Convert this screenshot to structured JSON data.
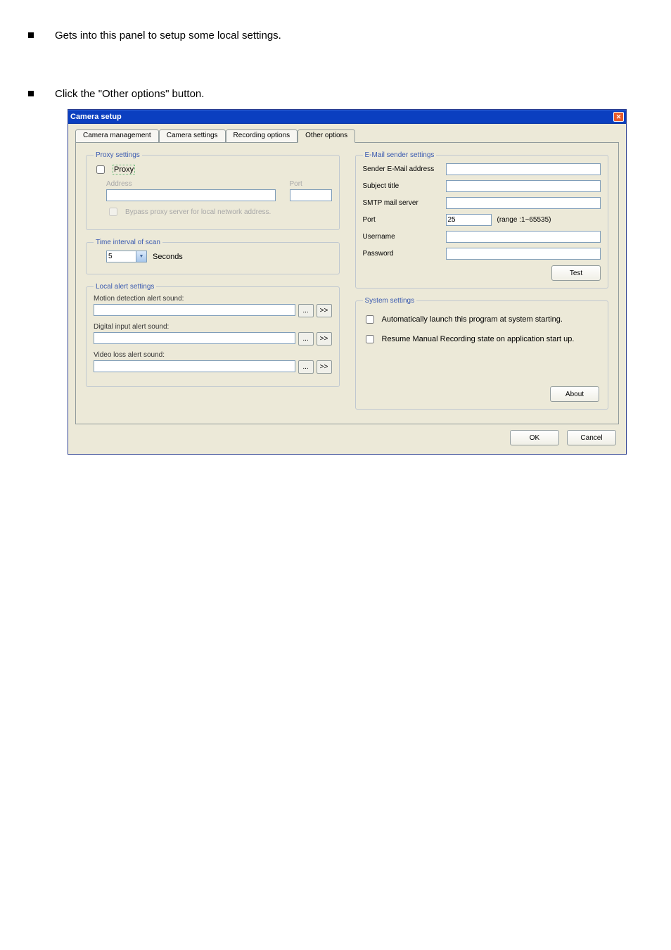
{
  "bullets": {
    "b1": "Gets into this panel to setup some local settings.",
    "b2_prefix": "Click the ",
    "b2_link": "\"Other options\"",
    "b2_suffix": " button."
  },
  "dialog": {
    "title": "Camera setup",
    "tabs": [
      {
        "label": "Camera management"
      },
      {
        "label": "Camera settings"
      },
      {
        "label": "Recording options"
      },
      {
        "label": "Other options"
      }
    ],
    "proxy": {
      "legend": "Proxy settings",
      "proxy_checkbox_label": "Proxy",
      "address_label": "Address",
      "port_label": "Port",
      "bypass_label": "Bypass proxy server for local network address."
    },
    "scan": {
      "legend": "Time interval of scan",
      "value": "5",
      "unit": "Seconds"
    },
    "alerts": {
      "legend": "Local alert settings",
      "motion_label": "Motion detection alert sound:",
      "digital_label": "Digital input alert sound:",
      "video_label": "Video loss alert sound:",
      "browse": "...",
      "play": ">>"
    },
    "email": {
      "legend": "E-Mail sender settings",
      "sender_label": "Sender E-Mail address",
      "subject_label": "Subject title",
      "smtp_label": "SMTP mail server",
      "port_label": "Port",
      "port_value": "25",
      "range_note": "(range :1~65535)",
      "username_label": "Username",
      "password_label": "Password",
      "test_btn": "Test"
    },
    "system": {
      "legend": "System settings",
      "auto_launch": "Automatically launch this program at system starting.",
      "resume_rec": "Resume Manual Recording state on application start up.",
      "about_btn": "About"
    },
    "ok": "OK",
    "cancel": "Cancel"
  }
}
